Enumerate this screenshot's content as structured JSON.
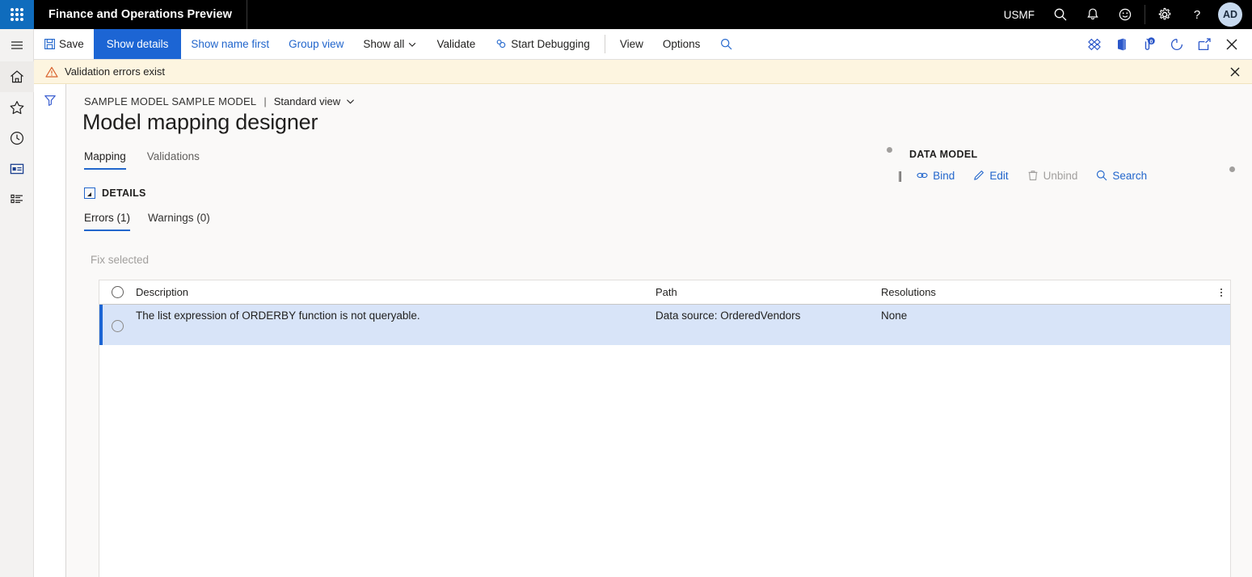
{
  "topbar": {
    "waffle_label": "app-launcher",
    "app_title": "Finance and Operations Preview",
    "company": "USMF",
    "icons": [
      "search-icon",
      "notifications-icon",
      "feedback-icon",
      "settings-icon",
      "help-icon"
    ],
    "avatar_initials": "AD"
  },
  "rail": {
    "items": [
      {
        "name": "menu-icon",
        "label": "Expand the navigation pane"
      },
      {
        "name": "home-icon",
        "label": "Home"
      },
      {
        "name": "favorites-star-icon",
        "label": "Favorites"
      },
      {
        "name": "recent-clock-icon",
        "label": "Recent"
      },
      {
        "name": "workspaces-icon",
        "label": "Workspaces"
      },
      {
        "name": "modules-list-icon",
        "label": "Modules"
      }
    ]
  },
  "toolbar": {
    "save_label": "Save",
    "show_details_label": "Show details",
    "show_name_first_label": "Show name first",
    "group_view_label": "Group view",
    "show_all_label": "Show all",
    "validate_label": "Validate",
    "start_debugging_label": "Start Debugging",
    "view_label": "View",
    "options_label": "Options",
    "search_icon": "search-icon",
    "right_icons": [
      {
        "name": "personalize-diamond-icon"
      },
      {
        "name": "office-app-icon"
      },
      {
        "name": "attachments-icon",
        "badge": "0"
      },
      {
        "name": "refresh-icon"
      },
      {
        "name": "open-in-new-window-icon"
      },
      {
        "name": "close-icon"
      }
    ]
  },
  "message_bar": {
    "icon": "warning-triangle-icon",
    "text": "Validation errors exist",
    "close_icon": "close-icon"
  },
  "filter_strip": {
    "icon": "filter-funnel-icon"
  },
  "page": {
    "breadcrumb_model": "SAMPLE MODEL SAMPLE MODEL",
    "breadcrumb_separator": "|",
    "breadcrumb_view": "Standard view",
    "title": "Model mapping designer",
    "tabs": [
      {
        "label": "Mapping",
        "active": true
      },
      {
        "label": "Validations",
        "active": false
      }
    ]
  },
  "data_model": {
    "title": "DATA MODEL",
    "actions": [
      {
        "label": "Bind",
        "icon": "link-icon",
        "disabled": false
      },
      {
        "label": "Edit",
        "icon": "pencil-icon",
        "disabled": false
      },
      {
        "label": "Unbind",
        "icon": "trash-icon",
        "disabled": true
      },
      {
        "label": "Search",
        "icon": "search-icon",
        "disabled": false
      }
    ]
  },
  "details": {
    "section_label": "DETAILS",
    "subtabs": [
      {
        "label": "Errors (1)",
        "active": true
      },
      {
        "label": "Warnings (0)",
        "active": false
      }
    ],
    "fix_selected_label": "Fix selected"
  },
  "grid": {
    "columns": [
      "Description",
      "Path",
      "Resolutions"
    ],
    "rows": [
      {
        "description": "The list expression of ORDERBY function is not queryable.",
        "path": "Data source: OrderedVendors",
        "resolutions": "None",
        "selected": true
      }
    ]
  },
  "colors": {
    "brand_blue": "#1c65d4",
    "link_blue": "#2266cc",
    "warning_bg": "#fdf5e0",
    "row_selected_bg": "#d8e4f8",
    "topbar_bg": "#000000",
    "waffle_bg": "#0f6cbd"
  }
}
